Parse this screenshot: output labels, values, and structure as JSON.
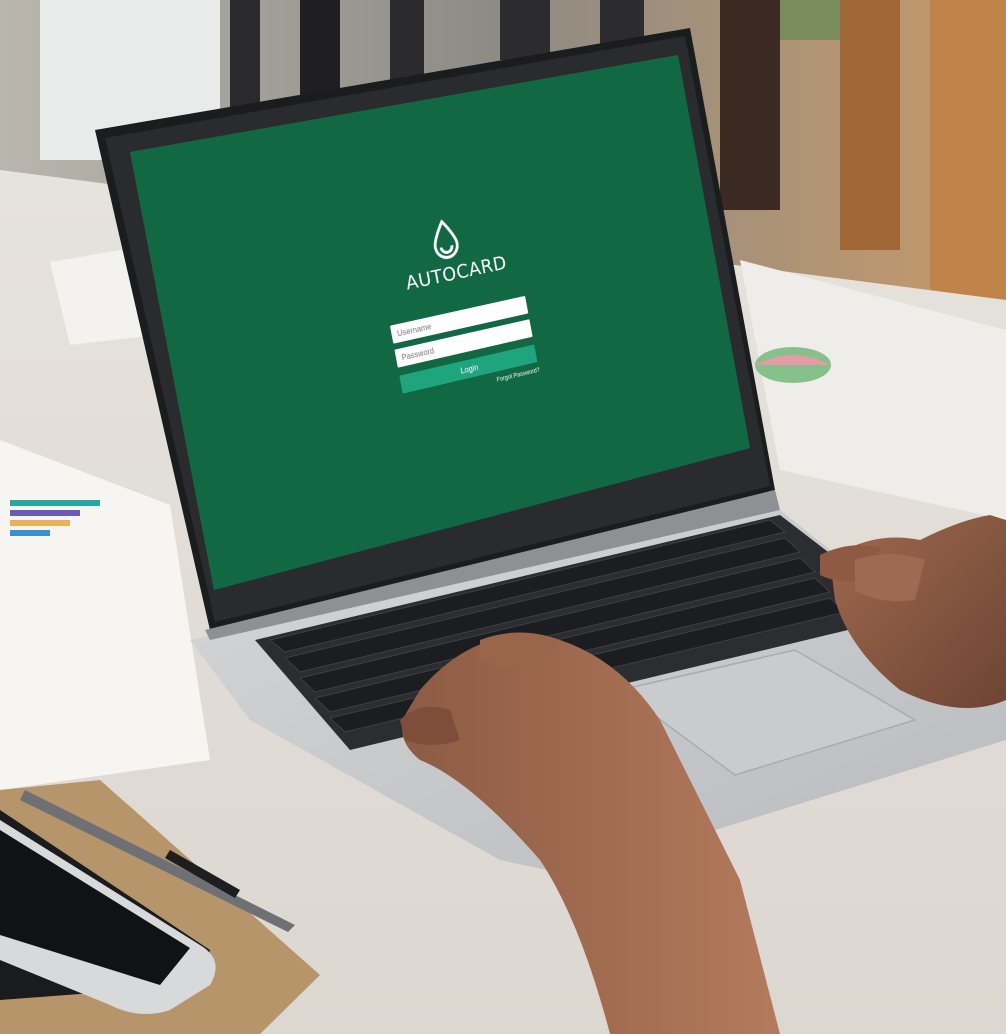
{
  "login": {
    "brand": "AUTOCARD",
    "username_placeholder": "Username",
    "password_placeholder": "Password",
    "login_label": "Login",
    "forgot_label": "Forgot Password?"
  },
  "colors": {
    "screen_bg": "#116843",
    "button_bg": "#1ea57e",
    "text": "#ffffff"
  },
  "icons": {
    "logo": "water-drop-icon"
  }
}
